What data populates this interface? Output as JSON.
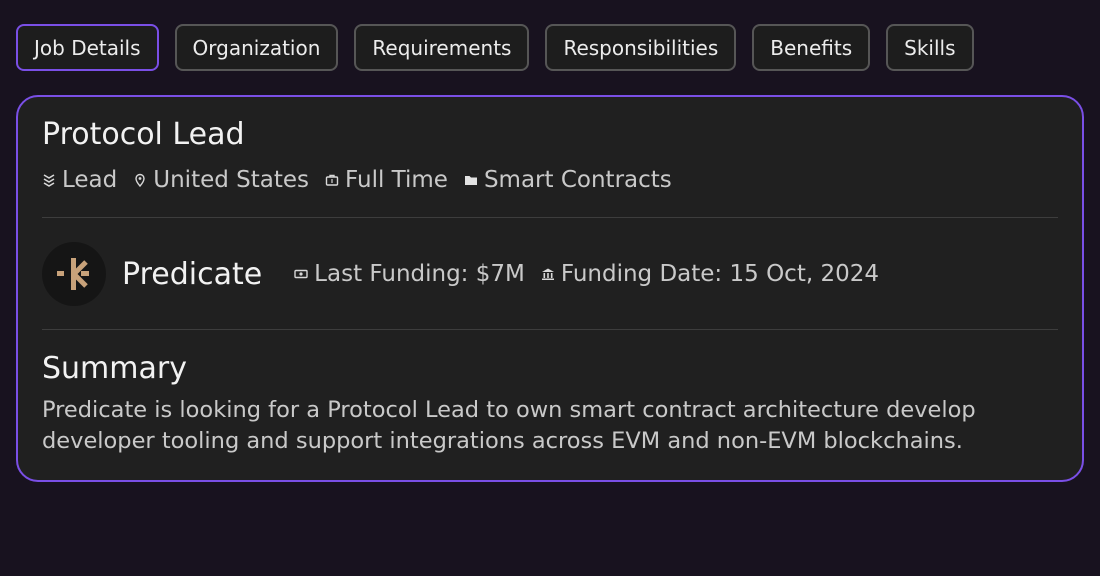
{
  "tabs": [
    {
      "label": "Job Details",
      "active": true
    },
    {
      "label": "Organization"
    },
    {
      "label": "Requirements"
    },
    {
      "label": "Responsibilities"
    },
    {
      "label": "Benefits"
    },
    {
      "label": "Skills"
    }
  ],
  "job": {
    "title": "Protocol Lead",
    "meta": {
      "level": {
        "label": "Lead",
        "icon": "level-icon"
      },
      "location": {
        "label": "United States",
        "icon": "location-pin-icon"
      },
      "type": {
        "label": "Full Time",
        "icon": "briefcase-icon"
      },
      "category": {
        "label": "Smart Contracts",
        "icon": "folder-icon"
      }
    }
  },
  "company": {
    "name": "Predicate",
    "logo_color": "#c8a27a",
    "last_funding": "Last Funding: $7M",
    "funding_date": "Funding Date: 15 Oct, 2024"
  },
  "summary": {
    "title": "Summary",
    "text": "Predicate is looking for a Protocol Lead to own smart contract architecture develop developer tooling and support integrations across EVM and non-EVM blockchains."
  },
  "colors": {
    "accent": "#7a4fe6",
    "background": "#18121f",
    "card": "#202020"
  }
}
